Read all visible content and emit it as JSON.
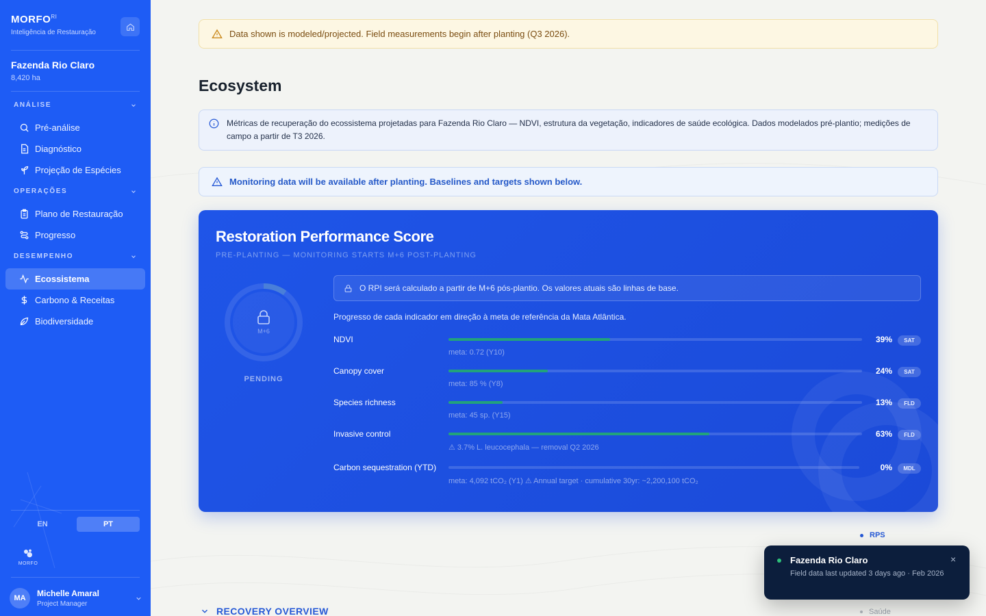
{
  "sidebar": {
    "brand": {
      "name": "MORFO",
      "superscript": "RI",
      "tagline": "Inteligência de Restauração"
    },
    "farm": {
      "name": "Fazenda Rio Claro",
      "area": "8,420 ha"
    },
    "sections": [
      {
        "title": "ANÁLISE",
        "items": [
          {
            "label": "Pré-análise",
            "icon": "search-icon"
          },
          {
            "label": "Diagnóstico",
            "icon": "document-icon"
          },
          {
            "label": "Projeção de Espécies",
            "icon": "sprout-icon"
          }
        ]
      },
      {
        "title": "OPERAÇÕES",
        "items": [
          {
            "label": "Plano de Restauração",
            "icon": "clipboard-icon"
          },
          {
            "label": "Progresso",
            "icon": "route-icon"
          }
        ]
      },
      {
        "title": "DESEMPENHO",
        "items": [
          {
            "label": "Ecossistema",
            "icon": "activity-icon",
            "active": true
          },
          {
            "label": "Carbono & Receitas",
            "icon": "dollar-icon"
          },
          {
            "label": "Biodiversidade",
            "icon": "leaf-icon"
          }
        ]
      }
    ],
    "languages": {
      "en": "EN",
      "pt": "PT",
      "selected": "PT"
    },
    "footer_logo_text": "MORFO",
    "user": {
      "initials": "MA",
      "name": "Michelle Amaral",
      "role": "Project Manager"
    }
  },
  "main": {
    "warning_banner": "Data shown is modeled/projected. Field measurements begin after planting (Q3 2026).",
    "page_title": "Ecosystem",
    "info_text": "Métricas de recuperação do ecossistema projetadas para Fazenda Rio Claro — NDVI, estrutura da vegetação, indicadores de saúde ecológica. Dados modelados pré-plantio; medições de campo a partir de T3 2026.",
    "monitoring_notice": "Monitoring data will be available after planting. Baselines and targets shown below.",
    "score_card": {
      "title": "Restoration Performance Score",
      "subtitle": "PRE-PLANTING — MONITORING STARTS M+6 POST-PLANTING",
      "ring_label": "M+6",
      "status": "PENDING",
      "rpi_note": "O RPI será calculado a partir de M+6 pós-plantio. Os valores atuais são linhas de base.",
      "indicator_intro": "Progresso de cada indicador em direção à meta de referência da Mata Atlântica.",
      "indicators": [
        {
          "label": "NDVI",
          "progress": 39,
          "pct": "39%",
          "badge": "SAT",
          "meta": "meta: 0.72 (Y10)"
        },
        {
          "label": "Canopy cover",
          "progress": 24,
          "pct": "24%",
          "badge": "SAT",
          "meta": "meta: 85 % (Y8)"
        },
        {
          "label": "Species richness",
          "progress": 13,
          "pct": "13%",
          "badge": "FLD",
          "meta": "meta: 45 sp. (Y15)"
        },
        {
          "label": "Invasive control",
          "progress": 63,
          "pct": "63%",
          "badge": "FLD",
          "meta": "⚠ 3.7% L. leucocephala — removal Q2 2026"
        },
        {
          "label": "Carbon sequestration (YTD)",
          "progress": 0,
          "pct": "0%",
          "badge": "MDL",
          "meta": "meta: 4,092 tCO₂ (Y1)   ⚠ Annual target · cumulative 30yr: ~2,200,100 tCO₂"
        }
      ]
    },
    "legend": {
      "rps": "RPS",
      "saude": "Saúde"
    },
    "recovery_overview": "RECOVERY OVERVIEW"
  },
  "toast": {
    "title": "Fazenda Rio Claro",
    "body": "Field data last updated 3 days ago · Feb 2026",
    "close": "×"
  },
  "colors": {
    "brand_blue": "#1e5cf5",
    "card_blue": "#1f55e8",
    "progress_green": "#22a37b",
    "warning_bg": "#fdf7e3"
  }
}
